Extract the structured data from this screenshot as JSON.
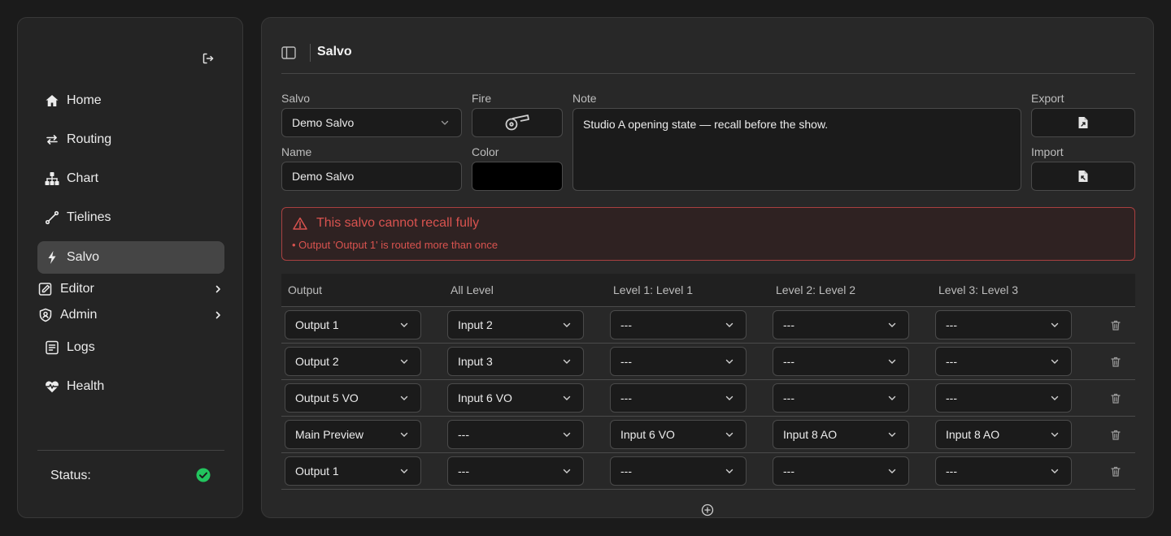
{
  "sidebar": {
    "items": [
      {
        "label": "Home",
        "icon": "home-icon"
      },
      {
        "label": "Routing",
        "icon": "routing-arrows-icon"
      },
      {
        "label": "Chart",
        "icon": "hierarchy-chart-icon"
      },
      {
        "label": "Tielines",
        "icon": "tieline-icon"
      },
      {
        "label": "Salvo",
        "icon": "lightning-icon"
      },
      {
        "label": "Editor",
        "icon": "edit-icon"
      },
      {
        "label": "Admin",
        "icon": "shield-user-icon"
      },
      {
        "label": "Logs",
        "icon": "document-icon"
      },
      {
        "label": "Health",
        "icon": "heartbeat-icon"
      }
    ],
    "status_label": "Status:",
    "status_color": "#22c55e"
  },
  "header": {
    "title": "Salvo"
  },
  "form": {
    "salvo_label": "Salvo",
    "salvo_value": "Demo Salvo",
    "fire_label": "Fire",
    "note_label": "Note",
    "note_value": "Studio A opening state — recall before the show.",
    "export_label": "Export",
    "import_label": "Import",
    "name_label": "Name",
    "name_value": "Demo Salvo",
    "color_label": "Color",
    "color_value": "#000000"
  },
  "alert": {
    "title": "This salvo cannot recall fully",
    "items": [
      "Output 'Output 1' is routed more than once"
    ],
    "color": "#d9534f"
  },
  "table": {
    "headers": [
      "Output",
      "All Level",
      "Level 1: Level 1",
      "Level 2: Level 2",
      "Level 3: Level 3"
    ],
    "rows": [
      [
        "Output 1",
        "Input 2",
        "---",
        "---",
        "---"
      ],
      [
        "Output 2",
        "Input 3",
        "---",
        "---",
        "---"
      ],
      [
        "Output 5 VO",
        "Input 6 VO",
        "---",
        "---",
        "---"
      ],
      [
        "Main Preview",
        "---",
        "Input 6 VO",
        "Input 8 AO",
        "Input 8 AO"
      ],
      [
        "Output 1",
        "---",
        "---",
        "---",
        "---"
      ]
    ]
  }
}
